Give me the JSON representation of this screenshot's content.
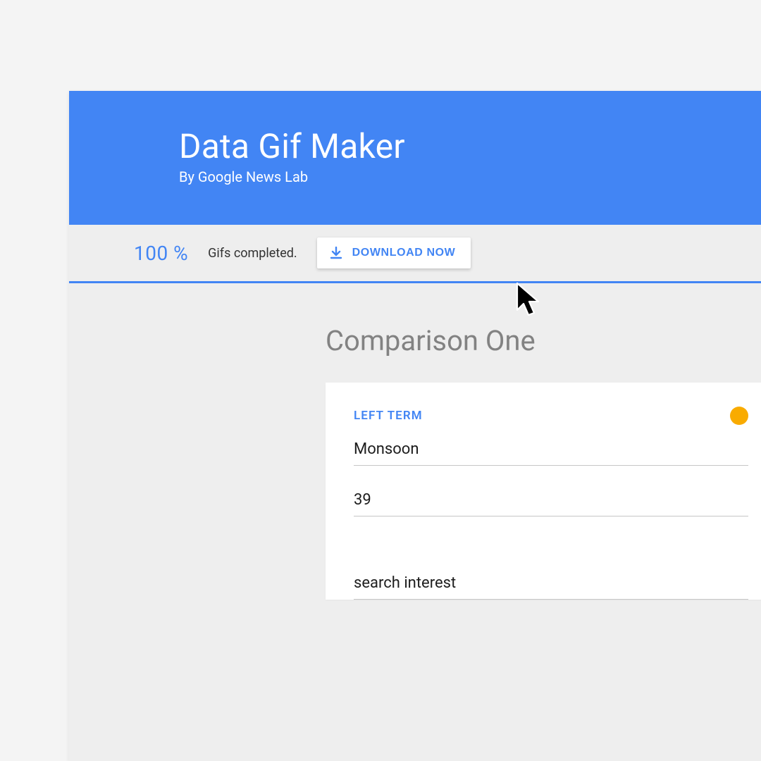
{
  "hero": {
    "title": "Data Gif Maker",
    "subtitle": "By Google News Lab"
  },
  "status": {
    "percent": "100 %",
    "message": "Gifs completed.",
    "download_label": "DOWNLOAD NOW"
  },
  "comparison": {
    "title": "Comparison One",
    "left": {
      "label": "LEFT TERM",
      "term_value": "Monsoon",
      "value": "39",
      "color": "#f9ab00"
    },
    "caption_value": "search interest"
  }
}
